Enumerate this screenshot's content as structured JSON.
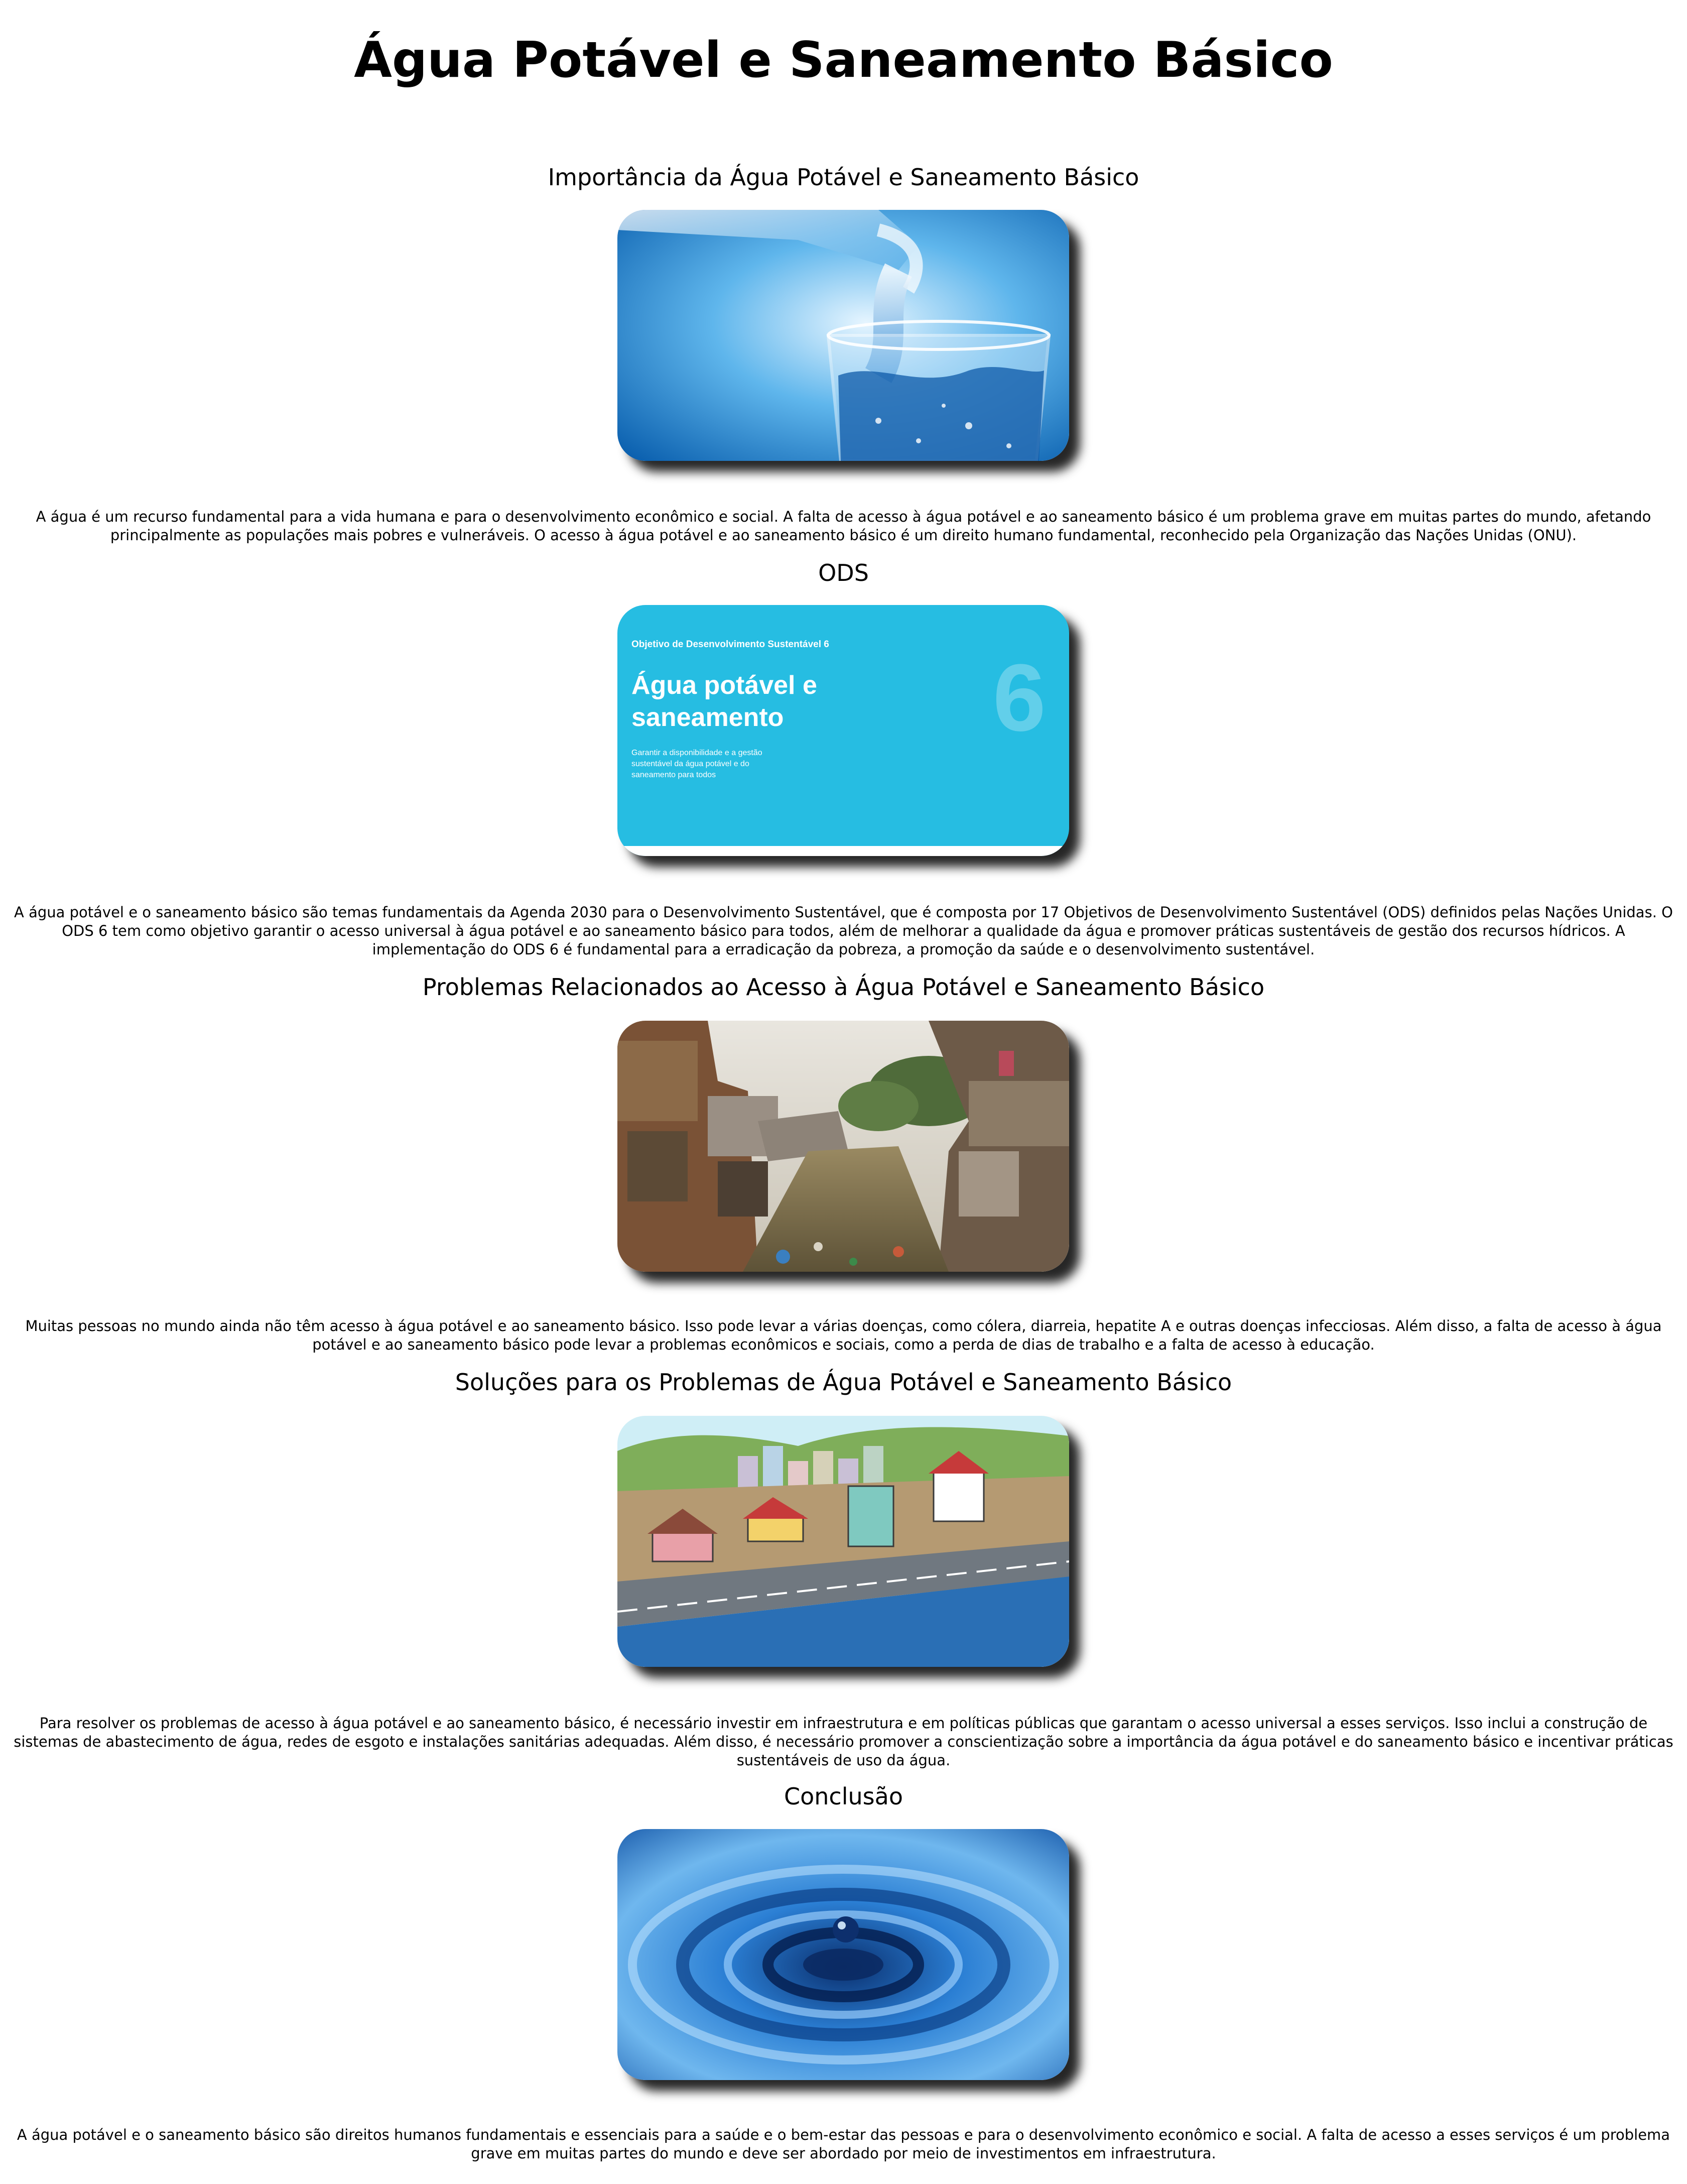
{
  "page": {
    "title": "Água Potável e Saneamento Básico"
  },
  "sections": [
    {
      "heading": "Importância da Água Potável e Saneamento Básico",
      "image": "water-pouring-into-glass",
      "paragraph": "A água é um recurso fundamental para a vida humana e para o desenvolvimento econômico e social. A falta de acesso à água potável e ao saneamento básico é um problema grave em muitas partes do mundo, afetando principalmente as populações mais pobres e vulneráveis. O acesso à água potável e ao saneamento básico é um direito humano fundamental, reconhecido pela Organização das Nações Unidas (ONU)."
    },
    {
      "heading": "ODS",
      "image": "ods-6-banner",
      "paragraph": "A água potável e o saneamento básico são temas fundamentais da Agenda 2030 para o Desenvolvimento Sustentável, que é composta por 17 Objetivos de Desenvolvimento Sustentável (ODS) definidos pelas Nações Unidas. O ODS 6 tem como objetivo garantir o acesso universal à água potável e ao saneamento básico para todos, além de melhorar a qualidade da água e promover práticas sustentáveis de gestão dos recursos hídricos. A implementação do ODS 6 é fundamental para a erradicação da pobreza, a promoção da saúde e o desenvolvimento sustentável."
    },
    {
      "heading": "Problemas Relacionados ao Acesso à Água Potável e Saneamento Básico",
      "image": "polluted-river-slum",
      "paragraph": "Muitas pessoas no mundo ainda não têm acesso à água potável e ao saneamento básico. Isso pode levar a várias doenças, como cólera, diarreia, hepatite A e outras doenças infecciosas. Além disso, a falta de acesso à água potável e ao saneamento básico pode levar a problemas econômicos e sociais, como a perda de dias de trabalho e a falta de acesso à educação."
    },
    {
      "heading": "Soluções para os Problemas de Água Potável e Saneamento Básico",
      "image": "sewage-system-illustration",
      "paragraph": "Para resolver os problemas de acesso à água potável e ao saneamento básico, é necessário investir em infraestrutura e em políticas públicas que garantam o acesso universal a esses serviços. Isso inclui a construção de sistemas de abastecimento de água, redes de esgoto e instalações sanitárias adequadas. Além disso, é necessário promover a conscientização sobre a importância da água potável e do saneamento básico e incentivar práticas sustentáveis de uso da água."
    },
    {
      "heading": "Conclusão",
      "image": "water-drop-ripple",
      "paragraph": "A água potável e o saneamento básico são direitos humanos fundamentais e essenciais para a saúde e o bem-estar das pessoas e para o desenvolvimento econômico e social. A falta de acesso a esses serviços é um problema grave em muitas partes do mundo e deve ser abordado por meio de investimentos em infraestrutura."
    }
  ],
  "ods_banner": {
    "subtitle": "Objetivo de Desenvolvimento Sustentável 6",
    "title": "Água potável e saneamento",
    "description": "Garantir a disponibilidade e a gestão sustentável da água potável e do saneamento para todos",
    "number": "6",
    "color": "#26bde2"
  }
}
